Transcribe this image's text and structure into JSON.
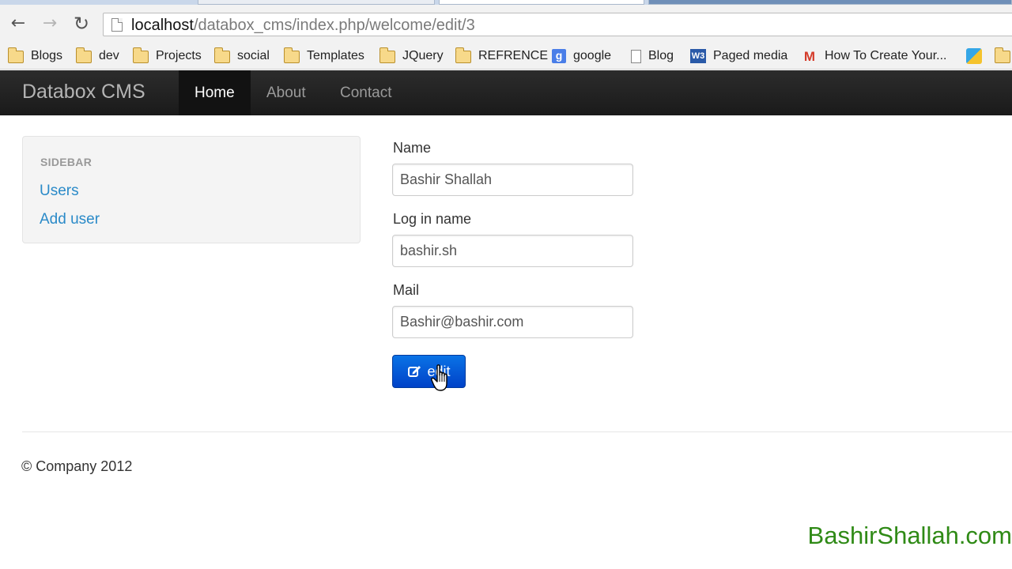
{
  "browser": {
    "url_host": "localhost",
    "url_path": "/databox_cms/index.php/welcome/edit/3",
    "bookmarks": [
      {
        "label": "Blogs",
        "icon": "folder-icon"
      },
      {
        "label": "dev",
        "icon": "folder-icon"
      },
      {
        "label": "Projects",
        "icon": "folder-icon"
      },
      {
        "label": "social",
        "icon": "folder-icon"
      },
      {
        "label": "Templates",
        "icon": "folder-icon"
      },
      {
        "label": "JQuery",
        "icon": "folder-icon"
      },
      {
        "label": "REFRENCE",
        "icon": "folder-icon"
      },
      {
        "label": "google",
        "icon": "google-icon"
      },
      {
        "label": "Blog",
        "icon": "page-icon"
      },
      {
        "label": "Paged media",
        "icon": "w3-icon"
      },
      {
        "label": "How To Create Your...",
        "icon": "gmail-icon"
      }
    ]
  },
  "navbar": {
    "brand": "Databox CMS",
    "items": [
      {
        "label": "Home",
        "active": true
      },
      {
        "label": "About",
        "active": false
      },
      {
        "label": "Contact",
        "active": false
      }
    ]
  },
  "sidebar": {
    "header": "SIDEBAR",
    "links": [
      "Users",
      "Add user"
    ]
  },
  "form": {
    "name_label": "Name",
    "name_value": "Bashir Shallah",
    "login_label": "Log in name",
    "login_value": "bashir.sh",
    "mail_label": "Mail",
    "mail_value": "Bashir@bashir.com",
    "submit_label": "edit"
  },
  "footer": {
    "copyright": "© Company 2012"
  },
  "watermark": "BashirShallah.com",
  "colors": {
    "link": "#2a8ac8",
    "primary_button": "#0055d4",
    "navbar": "#222222",
    "watermark": "#2f8a16"
  }
}
